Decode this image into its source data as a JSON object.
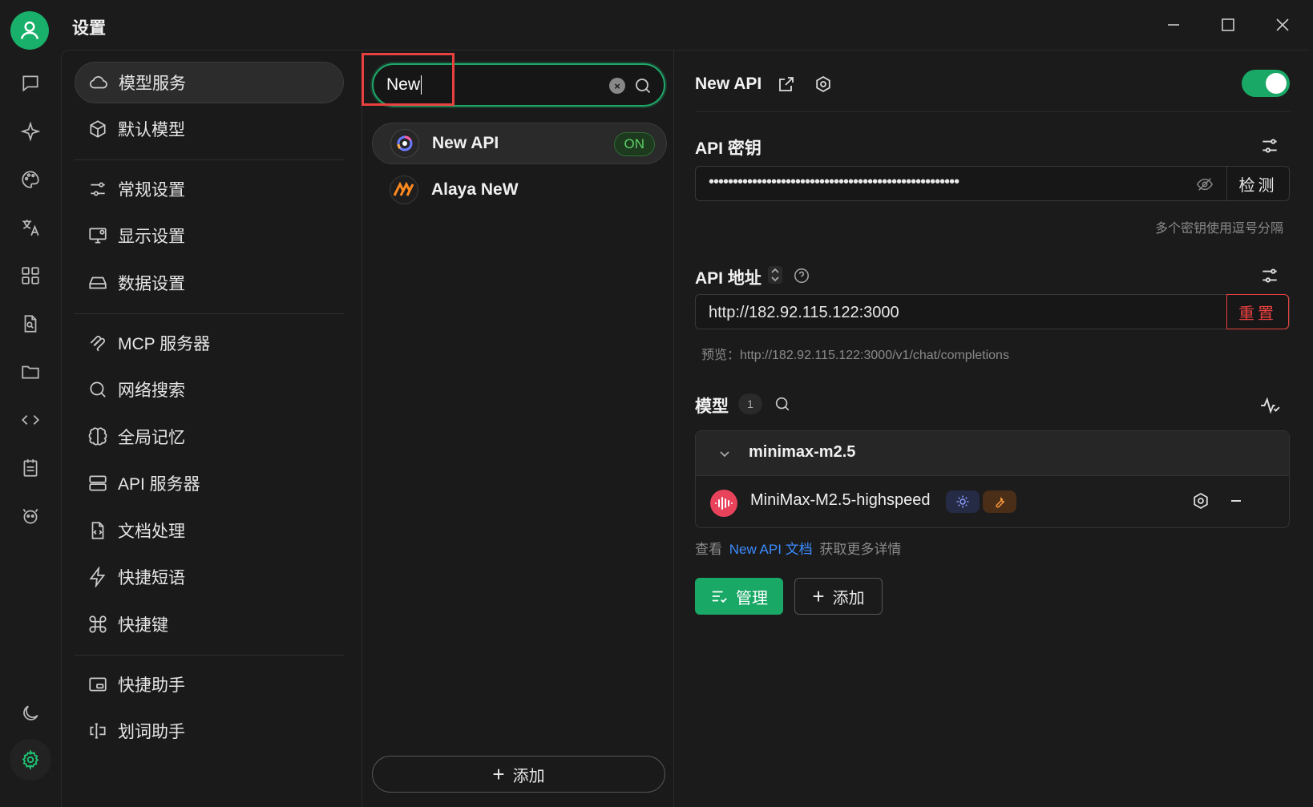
{
  "window": {
    "title": "设置",
    "controls": [
      "minimize-icon",
      "maximize-icon",
      "close-icon"
    ]
  },
  "rail": {
    "icons": [
      "chat-icon",
      "sparkle-icon",
      "palette-icon",
      "translate-icon",
      "apps-grid-icon",
      "document-search-icon",
      "folder-icon",
      "code-icon",
      "notepad-icon",
      "bot-icon",
      "moon-icon",
      "gear-icon"
    ],
    "active": "gear-icon"
  },
  "nav": {
    "items": [
      {
        "label": "模型服务",
        "icon": "cloud-icon",
        "active": true
      },
      {
        "label": "默认模型",
        "icon": "cube-icon"
      },
      {
        "label": "常规设置",
        "icon": "sliders-icon"
      },
      {
        "label": "显示设置",
        "icon": "monitor-gear-icon"
      },
      {
        "label": "数据设置",
        "icon": "hard-drive-icon"
      },
      {
        "label": "MCP 服务器",
        "icon": "mcp-icon"
      },
      {
        "label": "网络搜索",
        "icon": "search-icon"
      },
      {
        "label": "全局记忆",
        "icon": "brain-icon"
      },
      {
        "label": "API 服务器",
        "icon": "server-icon"
      },
      {
        "label": "文档处理",
        "icon": "file-code-icon"
      },
      {
        "label": "快捷短语",
        "icon": "lightning-icon"
      },
      {
        "label": "快捷键",
        "icon": "command-icon"
      },
      {
        "label": "快捷助手",
        "icon": "window-icon"
      },
      {
        "label": "划词助手",
        "icon": "text-cursor-icon"
      }
    ]
  },
  "providers": {
    "search": {
      "value": "New"
    },
    "list": [
      {
        "name": "New API",
        "badge": "ON",
        "active": true,
        "icon": "new-api-logo"
      },
      {
        "name": "Alaya NeW",
        "icon": "alaya-logo"
      }
    ],
    "add_label": "添加"
  },
  "detail": {
    "title": "New API",
    "enabled": true,
    "api_key": {
      "label": "API 密钥",
      "value": "••••••••••••••••••••••••••••••••••••••••••••••••••••",
      "check_label": "检测",
      "hint": "多个密钥使用逗号分隔"
    },
    "api_url": {
      "label": "API 地址",
      "value": "http://182.92.115.122:3000",
      "reset_label": "重置",
      "preview": "预览：http://182.92.115.122:3000/v1/chat/completions"
    },
    "models": {
      "label": "模型",
      "count": "1",
      "group": "minimax-m2.5",
      "items": [
        {
          "name": "MiniMax-M2.5-highspeed"
        }
      ],
      "doc_prefix": "查看",
      "doc_link": "New API 文档",
      "doc_suffix": "获取更多详情",
      "manage_label": "管理",
      "add_label": "添加"
    }
  },
  "colors": {
    "accent": "#19a866",
    "danger": "#e8413f",
    "link": "#3c8cff"
  }
}
